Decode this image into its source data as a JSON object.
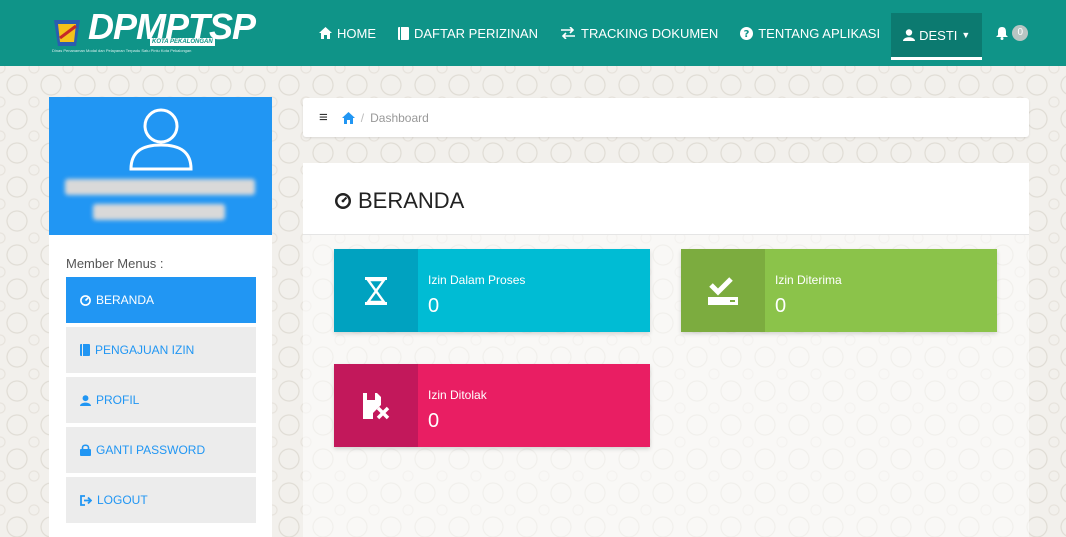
{
  "brand": {
    "name": "DPMPTSP",
    "badge": "KOTA PEKALONGAN",
    "tagline": "Dinas Penanaman Modal dan Pelayanan Terpadu Satu Pintu Kota Pekalongan"
  },
  "nav": {
    "items": [
      {
        "label": "HOME",
        "icon": "home-icon"
      },
      {
        "label": "DAFTAR PERIZINAN",
        "icon": "book-icon"
      },
      {
        "label": "TRACKING DOKUMEN",
        "icon": "exchange-icon"
      },
      {
        "label": "TENTANG APLIKASI",
        "icon": "question-circle-icon"
      }
    ],
    "user_label": "DESTI",
    "notification_count": "0"
  },
  "sidebar": {
    "menu_title": "Member Menus :",
    "items": [
      {
        "label": "BERANDA",
        "icon": "dashboard-icon"
      },
      {
        "label": "PENGAJUAN IZIN",
        "icon": "book-icon"
      },
      {
        "label": "PROFIL",
        "icon": "user-icon"
      },
      {
        "label": "GANTI PASSWORD",
        "icon": "lock-icon"
      },
      {
        "label": "LOGOUT",
        "icon": "sign-out-icon"
      }
    ]
  },
  "breadcrumb": {
    "current": "Dashboard"
  },
  "main": {
    "title": "BERANDA",
    "cards": [
      {
        "label": "Izin Dalam Proses",
        "value": "0",
        "icon": "hourglass-icon",
        "color": "#00bcd4"
      },
      {
        "label": "Izin Diterima",
        "value": "0",
        "icon": "check-tray-icon",
        "color": "#8bc34a"
      },
      {
        "label": "Izin Ditolak",
        "value": "0",
        "icon": "file-x-icon",
        "color": "#e91e63"
      }
    ]
  },
  "colors": {
    "navbar": "#0f9488",
    "primary": "#2196f3"
  }
}
